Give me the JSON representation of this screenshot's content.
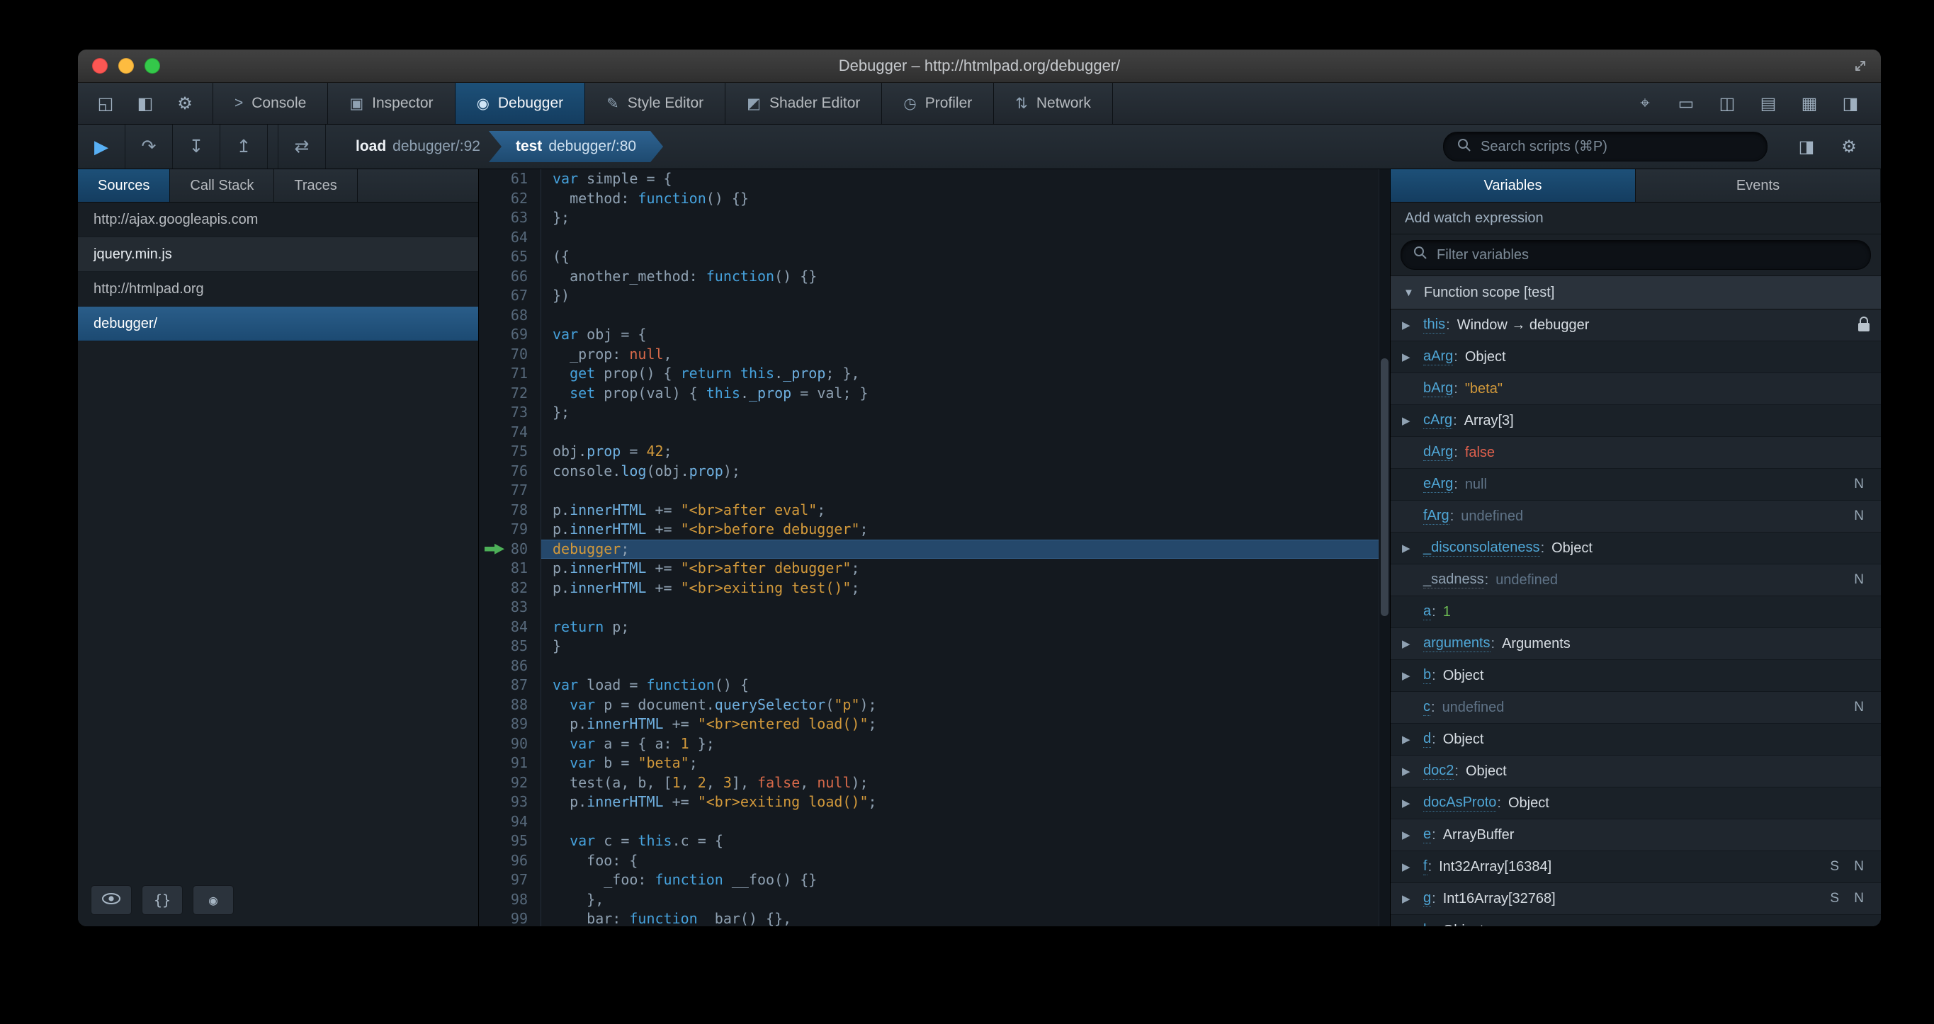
{
  "window": {
    "title": "Debugger – http://htmlpad.org/debugger/"
  },
  "devtools": {
    "left_icons": [
      {
        "name": "undock-window-icon",
        "glyph": "◱"
      },
      {
        "name": "toggle-sidebar-icon",
        "glyph": "◧"
      },
      {
        "name": "toolbox-options-icon",
        "glyph": "⚙"
      }
    ],
    "tabs": [
      {
        "label": "Console",
        "icon": "console-icon",
        "glyph": ">",
        "active": false
      },
      {
        "label": "Inspector",
        "icon": "inspector-icon",
        "glyph": "▣",
        "active": false
      },
      {
        "label": "Debugger",
        "icon": "debugger-icon",
        "glyph": "◉",
        "active": true
      },
      {
        "label": "Style Editor",
        "icon": "style-editor-icon",
        "glyph": "✎",
        "active": false
      },
      {
        "label": "Shader Editor",
        "icon": "shader-editor-icon",
        "glyph": "◩",
        "active": false
      },
      {
        "label": "Profiler",
        "icon": "profiler-icon",
        "glyph": "◷",
        "active": false
      },
      {
        "label": "Network",
        "icon": "network-icon",
        "glyph": "⇅",
        "active": false
      }
    ],
    "right_icons": [
      {
        "name": "pick-element-icon",
        "glyph": "⌖"
      },
      {
        "name": "split-console-icon",
        "glyph": "▭"
      },
      {
        "name": "responsive-mode-icon",
        "glyph": "◫"
      },
      {
        "name": "scratchpad-icon",
        "glyph": "▤"
      },
      {
        "name": "tilt-3d-icon",
        "glyph": "▦"
      },
      {
        "name": "eyedropper-icon",
        "glyph": "◨"
      }
    ]
  },
  "debugger_toolbar": {
    "buttons": [
      {
        "name": "resume-button",
        "glyph": "▶",
        "accent": true
      },
      {
        "name": "step-over-button",
        "glyph": "↷"
      },
      {
        "name": "step-in-button",
        "glyph": "↧"
      },
      {
        "name": "step-out-button",
        "glyph": "↥"
      },
      {
        "name": "toggle-breakpoints-button",
        "glyph": "⇄",
        "gap": true
      }
    ],
    "breadcrumbs": [
      {
        "fn": "load",
        "loc": "debugger/:92"
      },
      {
        "fn": "test",
        "loc": "debugger/:80"
      }
    ],
    "search_placeholder": "Search scripts (⌘P)",
    "right_icons": [
      {
        "name": "toggle-panes-icon",
        "glyph": "◨"
      },
      {
        "name": "debugger-options-icon",
        "glyph": "⚙"
      }
    ]
  },
  "sources_panel": {
    "tabs": [
      "Sources",
      "Call Stack",
      "Traces"
    ],
    "items": [
      {
        "label": "http://ajax.googleapis.com",
        "shaded": false,
        "selected": false
      },
      {
        "label": "jquery.min.js",
        "shaded": true,
        "selected": false
      },
      {
        "label": "http://htmlpad.org",
        "shaded": false,
        "selected": false
      },
      {
        "label": "debugger/",
        "shaded": false,
        "selected": true
      }
    ],
    "footer": {
      "buttons": [
        "blackbox-source-button",
        "prettyprint-button",
        "pause-on-exceptions-button"
      ],
      "prettyprint_glyph": "{}",
      "pause_glyph": "◉"
    }
  },
  "editor": {
    "first_line": 61,
    "exec_line": 80,
    "lines": [
      {
        "n": 61,
        "s": [
          [
            "kw",
            "var"
          ],
          [
            "",
            " simple = {"
          ]
        ]
      },
      {
        "n": 62,
        "s": [
          [
            "",
            "  method: "
          ],
          [
            "kw",
            "function"
          ],
          [
            "",
            "() {}"
          ]
        ]
      },
      {
        "n": 63,
        "s": [
          [
            "",
            "};"
          ]
        ]
      },
      {
        "n": 64,
        "s": []
      },
      {
        "n": 65,
        "s": [
          [
            "",
            "({"
          ]
        ]
      },
      {
        "n": 66,
        "s": [
          [
            "",
            "  another_method: "
          ],
          [
            "kw",
            "function"
          ],
          [
            "",
            "() {}"
          ]
        ]
      },
      {
        "n": 67,
        "s": [
          [
            "",
            "})"
          ]
        ]
      },
      {
        "n": 68,
        "s": []
      },
      {
        "n": 69,
        "s": [
          [
            "kw",
            "var"
          ],
          [
            "",
            " obj = {"
          ]
        ]
      },
      {
        "n": 70,
        "s": [
          [
            "",
            "  _prop: "
          ],
          [
            "atom",
            "null"
          ],
          [
            "",
            ","
          ]
        ]
      },
      {
        "n": 71,
        "s": [
          [
            "",
            "  "
          ],
          [
            "kw",
            "get"
          ],
          [
            "",
            " prop() { "
          ],
          [
            "kw",
            "return"
          ],
          [
            "",
            " "
          ],
          [
            "kw",
            "this"
          ],
          [
            "",
            "."
          ],
          [
            "pr",
            "_prop"
          ],
          [
            "",
            "; },"
          ]
        ]
      },
      {
        "n": 72,
        "s": [
          [
            "",
            "  "
          ],
          [
            "kw",
            "set"
          ],
          [
            "",
            " prop(val) { "
          ],
          [
            "kw",
            "this"
          ],
          [
            "",
            "."
          ],
          [
            "pr",
            "_prop"
          ],
          [
            "",
            " = val; }"
          ]
        ]
      },
      {
        "n": 73,
        "s": [
          [
            "",
            "};"
          ]
        ]
      },
      {
        "n": 74,
        "s": []
      },
      {
        "n": 75,
        "s": [
          [
            "",
            "obj."
          ],
          [
            "pr",
            "prop"
          ],
          [
            "",
            " = "
          ],
          [
            "num",
            "42"
          ],
          [
            "",
            ";"
          ]
        ]
      },
      {
        "n": 76,
        "s": [
          [
            "",
            "console."
          ],
          [
            "pr",
            "log"
          ],
          [
            "",
            "(obj."
          ],
          [
            "pr",
            "prop"
          ],
          [
            "",
            ");"
          ]
        ]
      },
      {
        "n": 77,
        "s": []
      },
      {
        "n": 78,
        "s": [
          [
            "",
            "p."
          ],
          [
            "pr",
            "innerHTML"
          ],
          [
            "",
            " += "
          ],
          [
            "st",
            "\"<br>after eval\""
          ],
          [
            "",
            ";"
          ]
        ]
      },
      {
        "n": 79,
        "s": [
          [
            "",
            "p."
          ],
          [
            "pr",
            "innerHTML"
          ],
          [
            "",
            " += "
          ],
          [
            "st",
            "\"<br>before debugger\""
          ],
          [
            "",
            ";"
          ]
        ]
      },
      {
        "n": 80,
        "s": [
          [
            "kw2",
            "debugger"
          ],
          [
            "",
            ";"
          ]
        ]
      },
      {
        "n": 81,
        "s": [
          [
            "",
            "p."
          ],
          [
            "pr",
            "innerHTML"
          ],
          [
            "",
            " += "
          ],
          [
            "st",
            "\"<br>after debugger\""
          ],
          [
            "",
            ";"
          ]
        ]
      },
      {
        "n": 82,
        "s": [
          [
            "",
            "p."
          ],
          [
            "pr",
            "innerHTML"
          ],
          [
            "",
            " += "
          ],
          [
            "st",
            "\"<br>exiting test()\""
          ],
          [
            "",
            ";"
          ]
        ]
      },
      {
        "n": 83,
        "s": []
      },
      {
        "n": 84,
        "s": [
          [
            "kw",
            "return"
          ],
          [
            "",
            " p;"
          ]
        ]
      },
      {
        "n": 85,
        "s": [
          [
            "",
            "}"
          ]
        ]
      },
      {
        "n": 86,
        "s": []
      },
      {
        "n": 87,
        "s": [
          [
            "kw",
            "var"
          ],
          [
            "",
            " load = "
          ],
          [
            "kw",
            "function"
          ],
          [
            "",
            "() {"
          ]
        ]
      },
      {
        "n": 88,
        "s": [
          [
            "",
            "  "
          ],
          [
            "kw",
            "var"
          ],
          [
            "",
            " p = document."
          ],
          [
            "pr",
            "querySelector"
          ],
          [
            "",
            "("
          ],
          [
            "st",
            "\"p\""
          ],
          [
            "",
            ");"
          ]
        ]
      },
      {
        "n": 89,
        "s": [
          [
            "",
            "  p."
          ],
          [
            "pr",
            "innerHTML"
          ],
          [
            "",
            " += "
          ],
          [
            "st",
            "\"<br>entered load()\""
          ],
          [
            "",
            ";"
          ]
        ]
      },
      {
        "n": 90,
        "s": [
          [
            "",
            "  "
          ],
          [
            "kw",
            "var"
          ],
          [
            "",
            " a = { a: "
          ],
          [
            "num",
            "1"
          ],
          [
            "",
            " };"
          ]
        ]
      },
      {
        "n": 91,
        "s": [
          [
            "",
            "  "
          ],
          [
            "kw",
            "var"
          ],
          [
            "",
            " b = "
          ],
          [
            "st",
            "\"beta\""
          ],
          [
            "",
            ";"
          ]
        ]
      },
      {
        "n": 92,
        "s": [
          [
            "",
            "  test(a, b, ["
          ],
          [
            "num",
            "1"
          ],
          [
            "",
            ", "
          ],
          [
            "num",
            "2"
          ],
          [
            "",
            ", "
          ],
          [
            "num",
            "3"
          ],
          [
            "",
            "], "
          ],
          [
            "atom",
            "false"
          ],
          [
            "",
            ", "
          ],
          [
            "atom",
            "null"
          ],
          [
            "",
            ");"
          ]
        ]
      },
      {
        "n": 93,
        "s": [
          [
            "",
            "  p."
          ],
          [
            "pr",
            "innerHTML"
          ],
          [
            "",
            " += "
          ],
          [
            "st",
            "\"<br>exiting load()\""
          ],
          [
            "",
            ";"
          ]
        ]
      },
      {
        "n": 94,
        "s": []
      },
      {
        "n": 95,
        "s": [
          [
            "",
            "  "
          ],
          [
            "kw",
            "var"
          ],
          [
            "",
            " c = "
          ],
          [
            "kw",
            "this"
          ],
          [
            "",
            ".c = {"
          ]
        ]
      },
      {
        "n": 96,
        "s": [
          [
            "",
            "    foo: {"
          ]
        ]
      },
      {
        "n": 97,
        "s": [
          [
            "",
            "      _foo: "
          ],
          [
            "kw",
            "function"
          ],
          [
            "",
            " __foo() {}"
          ]
        ]
      },
      {
        "n": 98,
        "s": [
          [
            "",
            "    },"
          ]
        ]
      },
      {
        "n": 99,
        "s": [
          [
            "",
            "    bar: "
          ],
          [
            "kw",
            "function"
          ],
          [
            "",
            " _bar() {},"
          ]
        ]
      }
    ]
  },
  "variables_panel": {
    "tabs": [
      "Variables",
      "Events"
    ],
    "watch_label": "Add watch expression",
    "filter_placeholder": "Filter variables",
    "scope": {
      "label": "Function scope [test]",
      "arrow_glyph": "▼"
    },
    "expand_glyph": "▶",
    "rows": [
      {
        "expand": true,
        "name": "this",
        "value": "Window → debugger",
        "vclass": "obj",
        "lock": true
      },
      {
        "expand": true,
        "name": "aArg",
        "value": "Object",
        "vclass": "obj"
      },
      {
        "expand": false,
        "name": "bArg",
        "value": "\"beta\"",
        "vclass": "str"
      },
      {
        "expand": true,
        "name": "cArg",
        "value": "Array[3]",
        "vclass": "obj"
      },
      {
        "expand": false,
        "name": "dArg",
        "value": "false",
        "vclass": "atom"
      },
      {
        "expand": false,
        "name": "eArg",
        "value": "null",
        "vclass": "undef",
        "flags": "N"
      },
      {
        "expand": false,
        "name": "fArg",
        "value": "undefined",
        "vclass": "undef",
        "flags": "N"
      },
      {
        "expand": true,
        "name": "_disconsolateness",
        "value": "Object",
        "vclass": "obj"
      },
      {
        "expand": false,
        "name": "_sadness",
        "value": "undefined",
        "vclass": "undef",
        "flags": "N",
        "dim": true
      },
      {
        "expand": false,
        "name": "a",
        "value": "1",
        "vclass": "num"
      },
      {
        "expand": true,
        "name": "arguments",
        "value": "Arguments",
        "vclass": "obj"
      },
      {
        "expand": true,
        "name": "b",
        "value": "Object",
        "vclass": "obj"
      },
      {
        "expand": false,
        "name": "c",
        "value": "undefined",
        "vclass": "undef",
        "flags": "N"
      },
      {
        "expand": true,
        "name": "d",
        "value": "Object",
        "vclass": "obj"
      },
      {
        "expand": true,
        "name": "doc2",
        "value": "Object",
        "vclass": "obj"
      },
      {
        "expand": true,
        "name": "docAsProto",
        "value": "Object",
        "vclass": "obj"
      },
      {
        "expand": true,
        "name": "e",
        "value": "ArrayBuffer",
        "vclass": "obj"
      },
      {
        "expand": true,
        "name": "f",
        "value": "Int32Array[16384]",
        "vclass": "obj",
        "flags": "S N"
      },
      {
        "expand": true,
        "name": "g",
        "value": "Int16Array[32768]",
        "vclass": "obj",
        "flags": "S N"
      },
      {
        "expand": true,
        "name": "h",
        "value": "Object",
        "vclass": "obj"
      }
    ]
  }
}
